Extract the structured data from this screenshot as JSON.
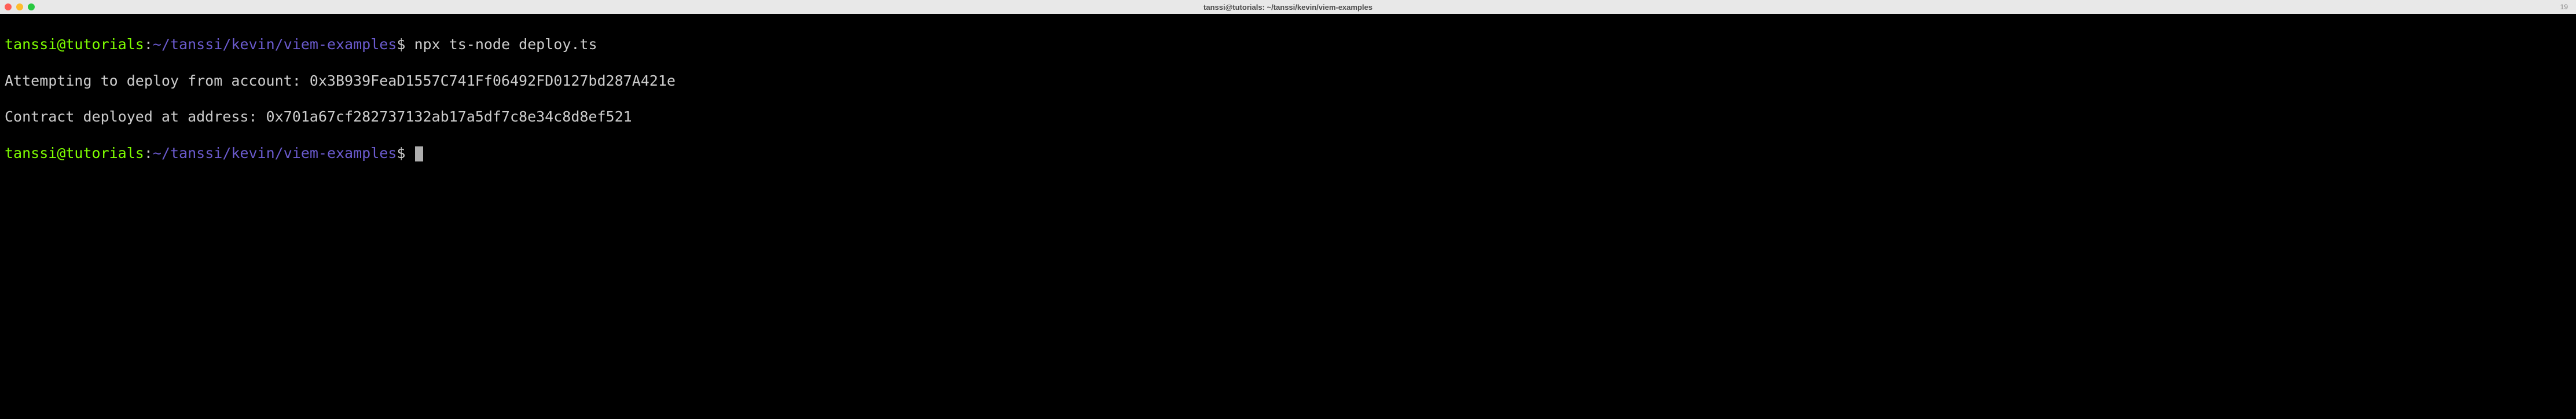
{
  "titlebar": {
    "title": "tanssi@tutorials: ~/tanssi/kevin/viem-examples",
    "right_indicator": "19"
  },
  "prompt": {
    "user": "tanssi",
    "at": "@",
    "host": "tutorials",
    "colon": ":",
    "path": "~/tanssi/kevin/viem-examples",
    "dollar": "$"
  },
  "lines": [
    {
      "command": " npx ts-node deploy.ts"
    },
    {
      "output": "Attempting to deploy from account: 0x3B939FeaD1557C741Ff06492FD0127bd287A421e"
    },
    {
      "output": "Contract deployed at address: 0x701a67cf282737132ab17a5df7c8e34c8d8ef521"
    }
  ]
}
